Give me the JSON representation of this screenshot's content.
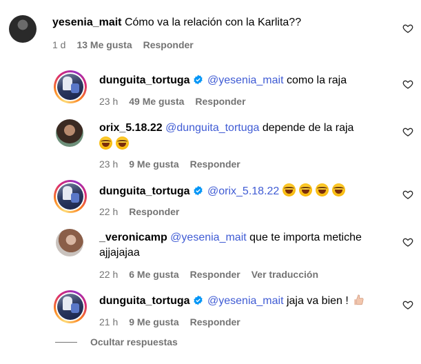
{
  "comments": [
    {
      "username": "yesenia_mait",
      "text": "Cómo va la relación con la Karlita??",
      "time": "1 d",
      "likes": "13 Me gusta",
      "reply": "Responder"
    },
    {
      "username": "dunguita_tortuga",
      "mention": "@yesenia_mait",
      "text": "como la raja",
      "time": "23 h",
      "likes": "49 Me gusta",
      "reply": "Responder"
    },
    {
      "username": "orix_5.18.22",
      "mention": "@dunguita_tortuga",
      "text": "depende de la raja",
      "time": "23 h",
      "likes": "9 Me gusta",
      "reply": "Responder"
    },
    {
      "username": "dunguita_tortuga",
      "mention": "@orix_5.18.22",
      "time": "22 h",
      "reply": "Responder"
    },
    {
      "username": "_veronicamp",
      "mention": "@yesenia_mait",
      "text": "que te importa metiche",
      "text2": "ajjajajaa",
      "time": "22 h",
      "likes": "6 Me gusta",
      "reply": "Responder",
      "translate": "Ver traducción"
    },
    {
      "username": "dunguita_tortuga",
      "mention": "@yesenia_mait",
      "text": "jaja va bien !",
      "time": "21 h",
      "likes": "9 Me gusta",
      "reply": "Responder"
    }
  ],
  "hide_replies": "Ocultar respuestas",
  "icons": {
    "heart": "heart-outline-icon",
    "verified": "verified-badge-icon",
    "laugh": "face-with-tears-of-joy-icon",
    "thumb": "thumbs-up-icon"
  },
  "colors": {
    "mention": "#3f5bd4",
    "meta": "#737373",
    "verified": "#0095f6"
  }
}
